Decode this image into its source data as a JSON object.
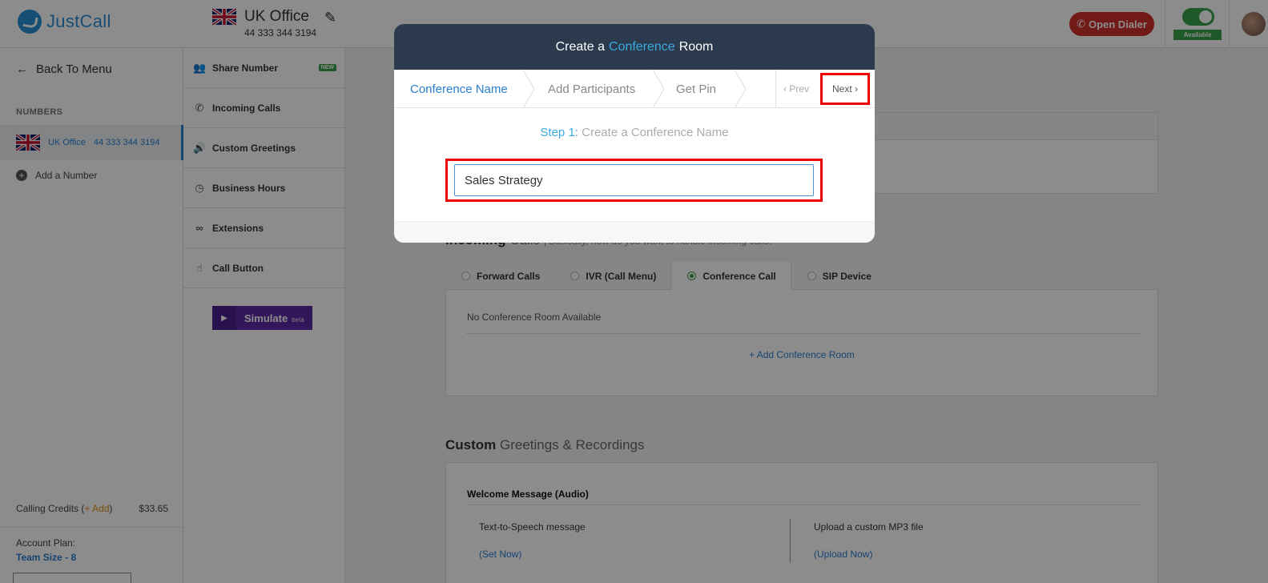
{
  "app": {
    "logo_text": "JustCall"
  },
  "header": {
    "office_name": "UK Office",
    "office_phone": "44 333 344 3194",
    "open_dialer": "Open Dialer",
    "status": "Available"
  },
  "sidebar": {
    "back": "Back To Menu",
    "numbers_heading": "NUMBERS",
    "number_name": "UK Office",
    "number_value": "44 333 344 3194",
    "add_number": "Add a Number",
    "credits_label": "Calling Credits",
    "credits_add": "+ Add",
    "credits_value": "$33.65",
    "plan_label": "Account Plan:",
    "plan_value": "Team Size - 8"
  },
  "menu": {
    "items": [
      {
        "label": "Share Number",
        "badge": "NEW"
      },
      {
        "label": "Incoming Calls"
      },
      {
        "label": "Custom Greetings"
      },
      {
        "label": "Business Hours"
      },
      {
        "label": "Extensions"
      },
      {
        "label": "Call Button"
      }
    ],
    "simulate": "Simulate",
    "simulate_beta": "beta"
  },
  "main": {
    "incoming_title_bold": "Incoming",
    "incoming_title_light": "Calls",
    "incoming_hint": "| Basically, how do you want to handle incoming calls?",
    "tabs": [
      "Forward Calls",
      "IVR (Call Menu)",
      "Conference Call",
      "SIP Device"
    ],
    "active_tab": "Conference Call",
    "no_room": "No Conference Room Available",
    "add_room": "Add Conference Room",
    "greetings_bold": "Custom",
    "greetings_light": "Greetings & Recordings",
    "welcome": "Welcome Message (Audio)",
    "tts": "Text-to-Speech message",
    "set_now": "(Set Now)",
    "upload": "Upload a custom MP3 file",
    "upload_now": "(Upload Now)"
  },
  "modal": {
    "title_a": "Create a",
    "title_hl": "Conference",
    "title_b": "Room",
    "steps": [
      "Conference Name",
      "Add Participants",
      "Get Pin"
    ],
    "prev": "Prev",
    "next": "Next",
    "step_num": "Step 1:",
    "step_text": "Create a Conference Name",
    "input_value": "Sales Strategy"
  },
  "colors": {
    "brand": "#2a8fd8",
    "accent": "#39a9e0",
    "danger": "#d0302b",
    "success": "#3aa14b",
    "header_dark": "#2b3a4c"
  }
}
